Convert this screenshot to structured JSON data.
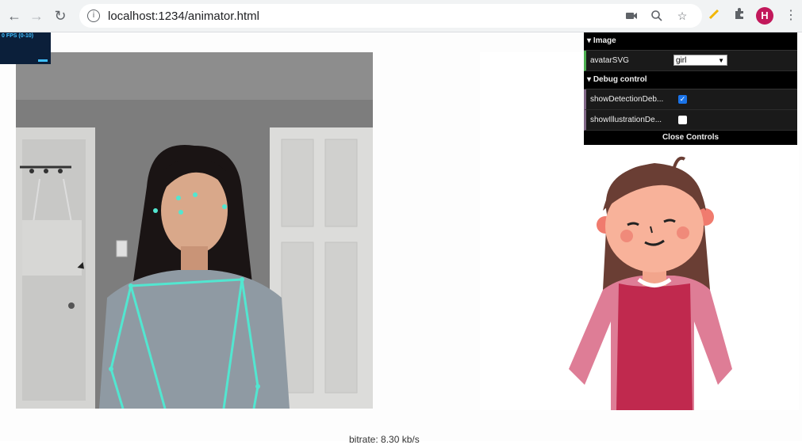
{
  "browser": {
    "url": "localhost:1234/animator.html",
    "avatar_letter": "H"
  },
  "fps_meter": {
    "label": "0 FPS (0-10)"
  },
  "controls": {
    "image_folder": "Image",
    "avatar_label": "avatarSVG",
    "avatar_value": "girl",
    "debug_folder": "Debug control",
    "show_detection_label": "showDetectionDeb...",
    "show_detection_checked": true,
    "show_illustration_label": "showIllustrationDe...",
    "show_illustration_checked": false,
    "close_label": "Close Controls"
  },
  "footer": {
    "bitrate_text": "bitrate: 8.30 kb/s"
  },
  "colors": {
    "skeleton": "#52e6d0",
    "shirt": "#c0294e",
    "cardigan": "#de7d96"
  }
}
